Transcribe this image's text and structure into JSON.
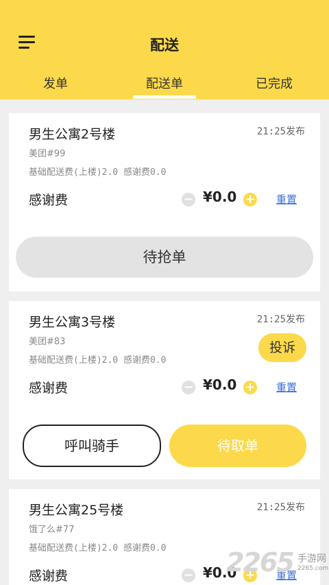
{
  "header": {
    "title": "配送",
    "tabs": [
      {
        "label": "发单"
      },
      {
        "label": "配送单"
      },
      {
        "label": "已完成"
      }
    ],
    "active_tab": 1
  },
  "orders": [
    {
      "building": "男生公寓2号楼",
      "time": "21:25发布",
      "store": "美团#99",
      "fee_text": "基础配送费(上楼)2.0 感谢费0.0",
      "thanks_label": "感谢费",
      "amount": "¥0.0",
      "reset_label": "重置",
      "action_label": "待抢单"
    },
    {
      "building": "男生公寓3号楼",
      "time": "21:25发布",
      "store": "美团#83",
      "fee_text": "基础配送费(上楼)2.0 感谢费0.0",
      "thanks_label": "感谢费",
      "amount": "¥0.0",
      "reset_label": "重置",
      "complain_label": "投诉",
      "call_label": "呼叫骑手",
      "action_label": "待取单"
    },
    {
      "building": "男生公寓25号楼",
      "time": "21:25发布",
      "store": "饿了么#77",
      "fee_text": "基础配送费(上楼)2.0 感谢费0.0",
      "thanks_label": "感谢费",
      "amount": "¥0.0",
      "reset_label": "重置"
    }
  ],
  "watermark": {
    "number": "2265",
    "site_name": "手游网",
    "url": "2265.com"
  },
  "colors": {
    "accent": "#fcd94a",
    "link": "#3b6fd6",
    "background": "#efefef"
  }
}
